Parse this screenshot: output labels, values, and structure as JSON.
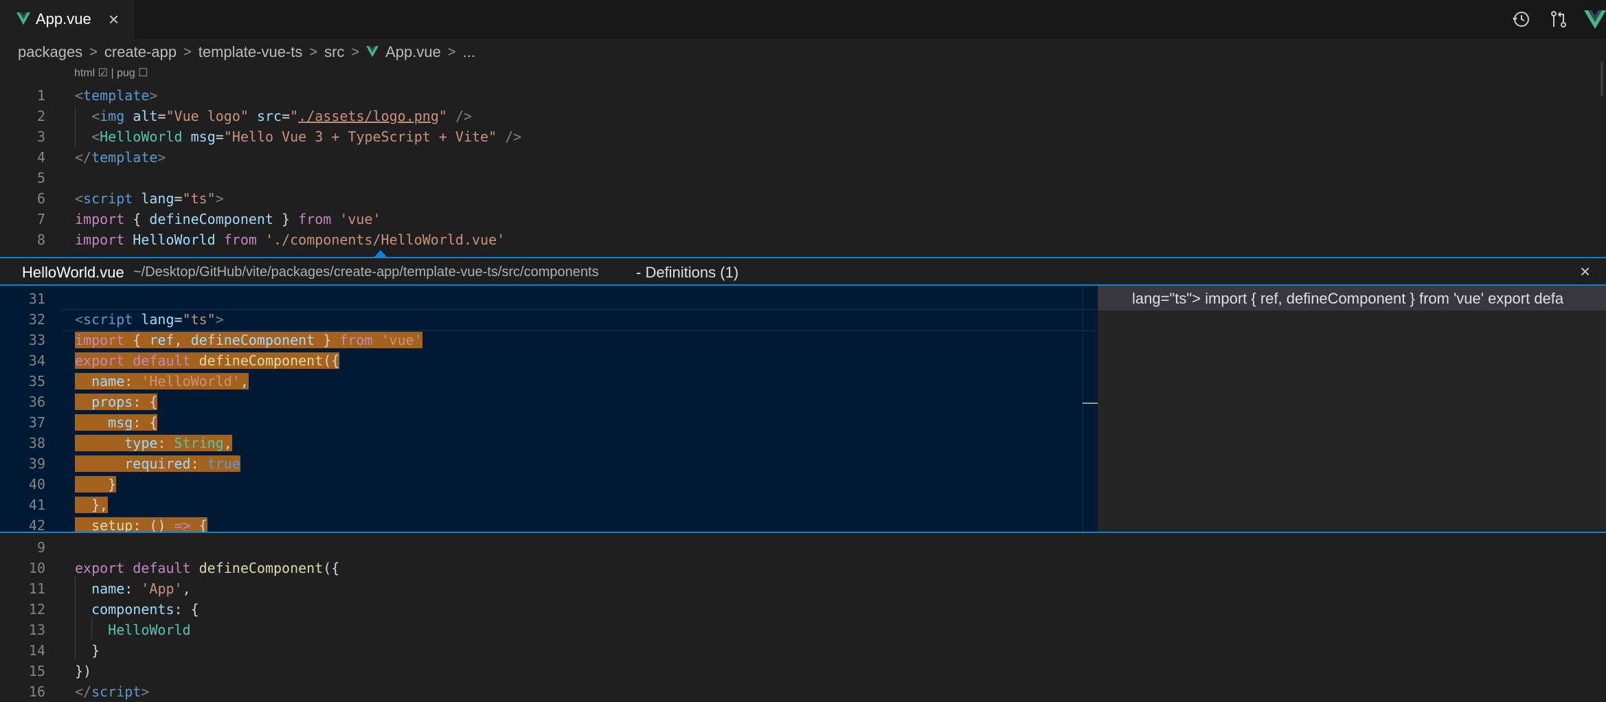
{
  "tab": {
    "label": "App.vue",
    "close": "×"
  },
  "toolbar_icons": [
    "history-icon",
    "source-control-compare-icon",
    "vue-icon"
  ],
  "breadcrumb": {
    "items": [
      "packages",
      "create-app",
      "template-vue-ts",
      "src",
      "App.vue",
      "..."
    ],
    "separator": ">"
  },
  "codelens": {
    "html": "html ☑ | pug ☐"
  },
  "editor_top": {
    "lines": [
      {
        "n": "1",
        "tokens": [
          [
            "punct",
            "<"
          ],
          [
            "tag",
            "template"
          ],
          [
            "punct",
            ">"
          ]
        ]
      },
      {
        "n": "2",
        "tokens": [
          [
            "plain",
            "  "
          ],
          [
            "punct",
            "<"
          ],
          [
            "tag",
            "img"
          ],
          [
            "plain",
            " "
          ],
          [
            "attr",
            "alt"
          ],
          [
            "plain",
            "="
          ],
          [
            "str",
            "\"Vue logo\""
          ],
          [
            "plain",
            " "
          ],
          [
            "attr",
            "src"
          ],
          [
            "plain",
            "="
          ],
          [
            "str",
            "\""
          ],
          [
            "strlink",
            "./assets/logo.png"
          ],
          [
            "str",
            "\""
          ],
          [
            "plain",
            " "
          ],
          [
            "punct",
            "/>"
          ]
        ]
      },
      {
        "n": "3",
        "tokens": [
          [
            "plain",
            "  "
          ],
          [
            "punct",
            "<"
          ],
          [
            "comp",
            "HelloWorld"
          ],
          [
            "plain",
            " "
          ],
          [
            "attr",
            "msg"
          ],
          [
            "plain",
            "="
          ],
          [
            "str",
            "\"Hello Vue 3 + TypeScript + Vite\""
          ],
          [
            "plain",
            " "
          ],
          [
            "punct",
            "/>"
          ]
        ]
      },
      {
        "n": "4",
        "tokens": [
          [
            "punct",
            "</"
          ],
          [
            "tag",
            "template"
          ],
          [
            "punct",
            ">"
          ]
        ]
      },
      {
        "n": "5",
        "tokens": []
      },
      {
        "n": "6",
        "tokens": [
          [
            "punct",
            "<"
          ],
          [
            "tag",
            "script"
          ],
          [
            "plain",
            " "
          ],
          [
            "attr",
            "lang"
          ],
          [
            "plain",
            "="
          ],
          [
            "str",
            "\"ts\""
          ],
          [
            "punct",
            ">"
          ]
        ]
      },
      {
        "n": "7",
        "tokens": [
          [
            "kw",
            "import"
          ],
          [
            "plain",
            " { "
          ],
          [
            "attr",
            "defineComponent"
          ],
          [
            "plain",
            " } "
          ],
          [
            "kw",
            "from"
          ],
          [
            "plain",
            " "
          ],
          [
            "str",
            "'vue'"
          ]
        ]
      },
      {
        "n": "8",
        "tokens": [
          [
            "kw",
            "import"
          ],
          [
            "plain",
            " "
          ],
          [
            "attr",
            "HelloWorld"
          ],
          [
            "plain",
            " "
          ],
          [
            "kw",
            "from"
          ],
          [
            "plain",
            " "
          ],
          [
            "str",
            "'./components/HelloWorld.vue'"
          ]
        ]
      }
    ]
  },
  "peek": {
    "title": "HelloWorld.vue",
    "path": "~/Desktop/GitHub/vite/packages/create-app/template-vue-ts/src/components",
    "definitions": "- Definitions (1)",
    "close": "×",
    "list_item": "lang=\"ts\"> import { ref, defineComponent } from 'vue' export defa",
    "lines": [
      {
        "n": "31",
        "tokens": []
      },
      {
        "n": "32",
        "tokens": [
          [
            "punct",
            "<"
          ],
          [
            "tag",
            "script"
          ],
          [
            "plain",
            " "
          ],
          [
            "attr",
            "lang"
          ],
          [
            "plain",
            "="
          ],
          [
            "str",
            "\"ts\""
          ],
          [
            "punct",
            ">"
          ]
        ]
      },
      {
        "n": "33",
        "tokens": [
          [
            "kw",
            "import"
          ],
          [
            "plain",
            " { "
          ],
          [
            "attr",
            "ref"
          ],
          [
            "plain",
            ", "
          ],
          [
            "attr",
            "defineComponent"
          ],
          [
            "plain",
            " } "
          ],
          [
            "kw",
            "from"
          ],
          [
            "plain",
            " "
          ],
          [
            "str",
            "'vue'"
          ]
        ]
      },
      {
        "n": "34",
        "tokens": [
          [
            "kw",
            "export"
          ],
          [
            "plain",
            " "
          ],
          [
            "kw",
            "default"
          ],
          [
            "plain",
            " "
          ],
          [
            "fn",
            "defineComponent"
          ],
          [
            "plain",
            "({"
          ]
        ]
      },
      {
        "n": "35",
        "tokens": [
          [
            "plain",
            "  "
          ],
          [
            "prop",
            "name"
          ],
          [
            "plain",
            ": "
          ],
          [
            "str",
            "'HelloWorld'"
          ],
          [
            "plain",
            ","
          ]
        ]
      },
      {
        "n": "36",
        "tokens": [
          [
            "plain",
            "  "
          ],
          [
            "prop",
            "props"
          ],
          [
            "plain",
            ": {"
          ]
        ]
      },
      {
        "n": "37",
        "tokens": [
          [
            "plain",
            "    "
          ],
          [
            "prop",
            "msg"
          ],
          [
            "plain",
            ": {"
          ]
        ]
      },
      {
        "n": "38",
        "tokens": [
          [
            "plain",
            "      "
          ],
          [
            "prop",
            "type"
          ],
          [
            "plain",
            ": "
          ],
          [
            "type",
            "String"
          ],
          [
            "plain",
            ","
          ]
        ]
      },
      {
        "n": "39",
        "tokens": [
          [
            "plain",
            "      "
          ],
          [
            "prop",
            "required"
          ],
          [
            "plain",
            ": "
          ],
          [
            "bool",
            "true"
          ]
        ]
      },
      {
        "n": "40",
        "tokens": [
          [
            "plain",
            "    }"
          ]
        ]
      },
      {
        "n": "41",
        "tokens": [
          [
            "plain",
            "  },"
          ]
        ]
      },
      {
        "n": "42",
        "tokens": [
          [
            "plain",
            "  "
          ],
          [
            "fn",
            "setup"
          ],
          [
            "plain",
            ": () "
          ],
          [
            "kw",
            "=>"
          ],
          [
            "plain",
            " {"
          ]
        ]
      }
    ]
  },
  "editor_bottom": {
    "lines": [
      {
        "n": "9",
        "tokens": []
      },
      {
        "n": "10",
        "tokens": [
          [
            "kw",
            "export"
          ],
          [
            "plain",
            " "
          ],
          [
            "kw",
            "default"
          ],
          [
            "plain",
            " "
          ],
          [
            "fn",
            "defineComponent"
          ],
          [
            "plain",
            "({"
          ]
        ]
      },
      {
        "n": "11",
        "tokens": [
          [
            "plain",
            "  "
          ],
          [
            "prop",
            "name"
          ],
          [
            "plain",
            ": "
          ],
          [
            "str",
            "'App'"
          ],
          [
            "plain",
            ","
          ]
        ]
      },
      {
        "n": "12",
        "tokens": [
          [
            "plain",
            "  "
          ],
          [
            "prop",
            "components"
          ],
          [
            "plain",
            ": {"
          ]
        ]
      },
      {
        "n": "13",
        "tokens": [
          [
            "plain",
            "    "
          ],
          [
            "comp",
            "HelloWorld"
          ]
        ]
      },
      {
        "n": "14",
        "tokens": [
          [
            "plain",
            "  }"
          ]
        ]
      },
      {
        "n": "15",
        "tokens": [
          [
            "plain",
            "})"
          ]
        ]
      },
      {
        "n": "16",
        "tokens": [
          [
            "punct",
            "</"
          ],
          [
            "tag",
            "script"
          ],
          [
            "punct",
            ">"
          ]
        ]
      }
    ]
  },
  "colors": {
    "peek_border": "#0a84d6",
    "peek_background": "#001a33",
    "highlight": "#a4621c",
    "vue_green": "#42b883"
  }
}
